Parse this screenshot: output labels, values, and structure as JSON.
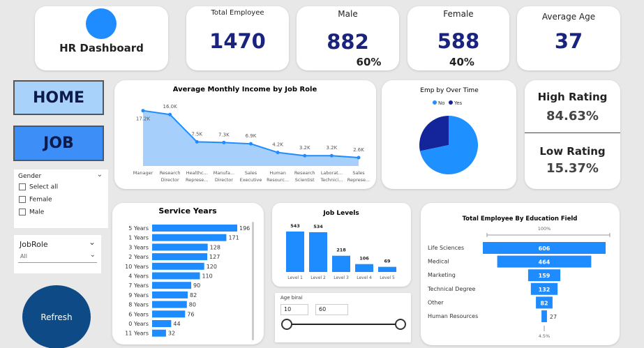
{
  "title": "HR Dashboard",
  "kpis": {
    "total": {
      "label": "Total Employee",
      "value": "1470"
    },
    "male": {
      "label": "Male",
      "value": "882",
      "pct": "60%"
    },
    "female": {
      "label": "Female",
      "value": "588",
      "pct": "40%"
    },
    "age": {
      "label": "Average Age",
      "value": "37"
    }
  },
  "nav": {
    "home": "HOME",
    "job": "JOB",
    "refresh": "Refresh"
  },
  "gender_slicer": {
    "title": "Gender",
    "options": [
      "Select all",
      "Female",
      "Male"
    ]
  },
  "jobrole_slicer": {
    "title": "JobRole",
    "value": "All"
  },
  "rating": {
    "high_label": "High Rating",
    "high_value": "84.63%",
    "low_label": "Low Rating",
    "low_value": "15.37%"
  },
  "overtime": {
    "title": "Emp by Over Time",
    "legend": [
      "No",
      "Yes"
    ]
  },
  "age_slider": {
    "title": "Age birai",
    "min": "10",
    "max": "60"
  },
  "colors": {
    "accent": "#1e90ff",
    "dark_navy": "#1a237e",
    "yes_navy": "#14249b",
    "nav_blue": "#3d8ef7",
    "refresh": "#0d4a86"
  },
  "chart_data": [
    {
      "type": "area",
      "title": "Average Monthly Income by Job Role",
      "categories": [
        [
          "Manager"
        ],
        [
          "Research",
          "Director"
        ],
        [
          "Healthc...",
          "Represe..."
        ],
        [
          "Manufa...",
          "Director"
        ],
        [
          "Sales",
          "Executive"
        ],
        [
          "Human",
          "Resourc..."
        ],
        [
          "Research",
          "Scientist"
        ],
        [
          "Laborat...",
          "Technici..."
        ],
        [
          "Sales",
          "Represe..."
        ]
      ],
      "values": [
        17.2,
        16.0,
        7.5,
        7.3,
        6.9,
        4.2,
        3.2,
        3.2,
        2.6
      ],
      "labels": [
        "17.2K",
        "16.0K",
        "7.5K",
        "7.3K",
        "6.9K",
        "4.2K",
        "3.2K",
        "3.2K",
        "2.6K"
      ],
      "ylim": [
        0,
        18
      ]
    },
    {
      "type": "pie",
      "title": "Emp by Over Time",
      "categories": [
        "No",
        "Yes"
      ],
      "values": [
        1054,
        416
      ]
    },
    {
      "type": "bar",
      "title": "Service Years",
      "categories": [
        "5 Years",
        "1 Years",
        "3 Years",
        "2 Years",
        "10 Years",
        "4 Years",
        "7 Years",
        "9 Years",
        "8 Years",
        "6 Years",
        "0 Years",
        "11 Years"
      ],
      "values": [
        196,
        171,
        128,
        127,
        120,
        110,
        90,
        82,
        80,
        76,
        44,
        32
      ]
    },
    {
      "type": "bar",
      "title": "Job Levels",
      "categories": [
        "Level 1",
        "Level 2",
        "Level 3",
        "Level 4",
        "Level 5"
      ],
      "values": [
        543,
        534,
        218,
        106,
        69
      ]
    },
    {
      "type": "bar",
      "title": "Total Employee By Education Field",
      "categories": [
        "Life Sciences",
        "Medical",
        "Marketing",
        "Technical Degree",
        "Other",
        "Human Resources"
      ],
      "values": [
        606,
        464,
        159,
        132,
        82,
        27
      ],
      "top_label": "100%",
      "bottom_label": "4.5%"
    }
  ]
}
